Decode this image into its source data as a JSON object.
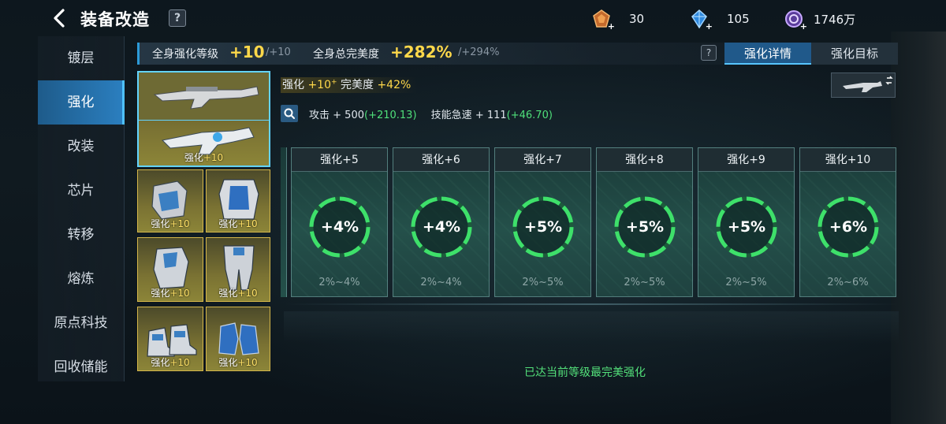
{
  "header": {
    "title": "装备改造",
    "help": "?"
  },
  "currencies": [
    {
      "icon": "enhance-stone-icon",
      "value": "30"
    },
    {
      "icon": "blue-crystal-icon",
      "value": "105"
    },
    {
      "icon": "credit-coin-icon",
      "value": "1746万"
    }
  ],
  "sidebar": {
    "items": [
      {
        "label": "镀层"
      },
      {
        "label": "强化"
      },
      {
        "label": "改装"
      },
      {
        "label": "芯片"
      },
      {
        "label": "转移"
      },
      {
        "label": "熔炼"
      },
      {
        "label": "原点科技"
      },
      {
        "label": "回收储能"
      }
    ],
    "active": "强化"
  },
  "summary": {
    "level_label": "全身强化等级",
    "level_value": "+10",
    "level_max": "/+10",
    "perfect_label": "全身总完美度",
    "perfect_value": "+282%",
    "perfect_max": "/+294%",
    "help": "?"
  },
  "tabs": [
    {
      "label": "强化详情",
      "active": true
    },
    {
      "label": "强化目标",
      "active": false
    }
  ],
  "equipment": {
    "slots": [
      {
        "name": "primary-weapon",
        "label": "",
        "plus": ""
      },
      {
        "name": "secondary-weapon",
        "label": "强化",
        "plus": "+10"
      },
      {
        "name": "shoulder-armor",
        "label": "强化",
        "plus": "+10"
      },
      {
        "name": "chest-armor",
        "label": "强化",
        "plus": "+10"
      },
      {
        "name": "arm-armor",
        "label": "强化",
        "plus": "+10"
      },
      {
        "name": "leg-armor",
        "label": "强化",
        "plus": "+10"
      },
      {
        "name": "boots",
        "label": "强化",
        "plus": "+10"
      },
      {
        "name": "gloves",
        "label": "强化",
        "plus": "+10"
      }
    ]
  },
  "weapon_info": {
    "enhance_label": "强化",
    "enhance_value": "+10",
    "enhance_sup": "+",
    "perfect_label": "完美度",
    "perfect_value": "+42%",
    "attack_label": "攻击",
    "attack_value": "+ 500",
    "attack_bonus": "(+210.13)",
    "skill_label": "技能急速",
    "skill_value": "+ 111",
    "skill_bonus": "(+46.70)"
  },
  "level_cards": [
    {
      "title": "强化+5",
      "value": "+4%",
      "range": "2%~4%"
    },
    {
      "title": "强化+6",
      "value": "+4%",
      "range": "2%~4%"
    },
    {
      "title": "强化+7",
      "value": "+5%",
      "range": "2%~5%"
    },
    {
      "title": "强化+8",
      "value": "+5%",
      "range": "2%~5%"
    },
    {
      "title": "强化+9",
      "value": "+5%",
      "range": "2%~5%"
    },
    {
      "title": "强化+10",
      "value": "+6%",
      "range": "2%~6%"
    }
  ],
  "status_message": "已达当前等级最完美强化",
  "colors": {
    "accent_blue": "#2b7fc0",
    "gold": "#ffd84a",
    "green": "#4fe07a"
  }
}
